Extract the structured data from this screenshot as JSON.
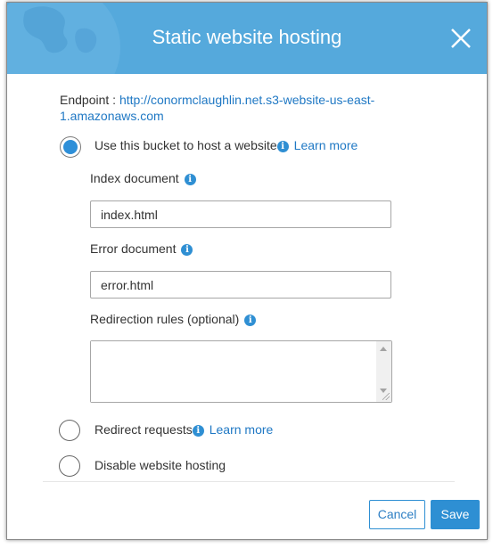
{
  "dialog": {
    "title": "Static website hosting",
    "close_icon": "close-icon"
  },
  "endpoint": {
    "label": "Endpoint : ",
    "url": "http://conormclaughlin.net.s3-website-us-east-1.amazonaws.com"
  },
  "options": {
    "host": {
      "label": "Use this bucket to host a website",
      "learn_more": "Learn more",
      "selected": true
    },
    "redirect": {
      "label": "Redirect requests",
      "learn_more": "Learn more",
      "selected": false
    },
    "disable": {
      "label": "Disable website hosting",
      "selected": false
    }
  },
  "fields": {
    "index_document": {
      "label": "Index document",
      "value": "index.html"
    },
    "error_document": {
      "label": "Error document",
      "value": "error.html"
    },
    "redirection_rules": {
      "label": "Redirection rules (optional)",
      "value": ""
    }
  },
  "info_icon_glyph": "i",
  "footer": {
    "cancel_label": "Cancel",
    "save_label": "Save"
  },
  "colors": {
    "header": "#55a9dc",
    "accent": "#2e8fd3",
    "link": "#1f78c4"
  }
}
